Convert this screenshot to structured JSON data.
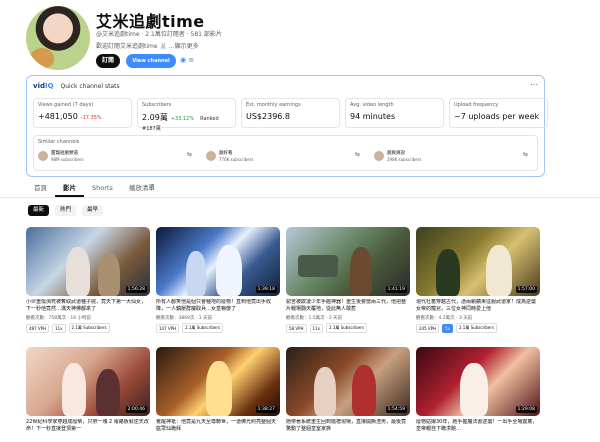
{
  "channel": {
    "name": "艾米追劇time",
    "meta": "@艾米追劇time · 2.1萬位訂閱者 · 581 部影片",
    "description": "歡迎訂閱艾米追劇time 🐰 ...顯示更多",
    "subscribe_label": "訂閱",
    "stats_label": "View channel stats"
  },
  "vidiq": {
    "logo_a": "vid",
    "logo_b": "IQ",
    "title": "Quick channel stats",
    "more": "⋯",
    "stats": [
      {
        "label": "Views gained (7 days)",
        "value": "+481,050",
        "delta": "-17.35%",
        "delta_type": "down"
      },
      {
        "label": "Subscribers",
        "value": "2.09萬",
        "delta": "+33.12%",
        "delta_type": "up",
        "rank": "Ranked #187萬"
      },
      {
        "label": "Est. monthly earnings",
        "value": "US$2396.8"
      },
      {
        "label": "Avg. video length",
        "value": "94 minutes"
      },
      {
        "label": "Upload frequency",
        "value": "~7 uploads per week"
      }
    ],
    "similar_label": "Similar channels",
    "similar": [
      {
        "name": "甜寵短劇頻道",
        "subs": "98M subscribers"
      },
      {
        "name": "劇好看",
        "subs": "776K subscribers"
      },
      {
        "name": "劇爽爽說",
        "subs": "298K subscribers"
      }
    ]
  },
  "tabs": [
    "首頁",
    "影片",
    "Shorts",
    "播放清單"
  ],
  "active_tab": 1,
  "chips": [
    "最新",
    "熱門",
    "最早"
  ],
  "videos": [
    {
      "title": "小伙重傷瀕死被奪取武道種子屍，竟天下第一大仙女，下一秒他竟然…滿天神佛都來了",
      "meta": "觀看次數：758萬次 · 16 小時前",
      "duration": "1:56:28",
      "vph": "487 VPH",
      "mult": "11x",
      "subs": "2.1萬 Subscribers"
    },
    {
      "title": "所有人都笑他是個只會種地的廢物！直到他竟出手收降，一人鎮壓群魔取兵…女皇嚇傻了",
      "meta": "觀看次數：3869次 · 1 天前",
      "duration": "1:39:18",
      "vph": "147 VPH",
      "mult": "",
      "subs": "2.1萬 Subscribers"
    },
    {
      "title": "窮苦被欺凌少年手握神器！重生後要當兩三代，他把整片戰場翻天覆地，從此無人敢惹",
      "meta": "觀看次數：1.5萬次 · 2 天前",
      "duration": "1:41:19",
      "vph": "58 VPH",
      "mult": "11x",
      "subs": "2.1萬 Subscribers"
    },
    {
      "title": "現代社畜穿越古代，憑兩顆蘋果征服武道家！成為逆襲女帝的寵兒，三位女神同時愛上他",
      "meta": "觀看次數：4.2萬次 · 3 天前",
      "duration": "1:57:00",
      "vph": "245 VPH",
      "mult": "5x",
      "subs": "2.1萬 Subscribers"
    },
    {
      "title": "22世紀科學家穿越成廢柴，只帶一塊 2 電路板就逆天改命！下一秒直接登頂第一",
      "meta": "",
      "duration": "2:00:46",
      "vph": "",
      "mult": "",
      "subs": ""
    },
    {
      "title": "覺醒神祇：他竟是九天至尊轉世，一道佛光照亮整個天庭眾仙跪拜",
      "meta": "",
      "duration": "1:38:27",
      "vph": "",
      "mult": "",
      "subs": ""
    },
    {
      "title": "她帶著系統重生回到婚禮現場，直接開撕渣男，最後竟驚動了整個皇室家族",
      "meta": "",
      "duration": "1:54:59",
      "vph": "",
      "mult": "",
      "subs": ""
    },
    {
      "title": "廢物姑娘30年，她手握魔法書逆襲！一出手全場震驚，皇帝親自下跪求饒…",
      "meta": "",
      "duration": "1:29:08",
      "vph": "",
      "mult": "",
      "subs": ""
    }
  ]
}
